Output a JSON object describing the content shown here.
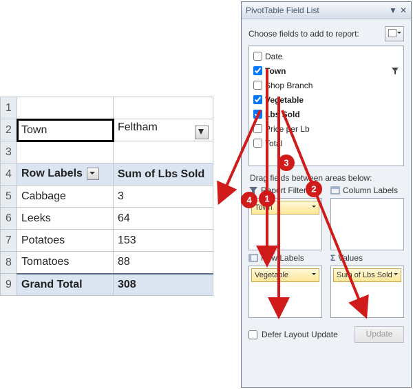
{
  "sheet": {
    "rows": [
      "1",
      "2",
      "3",
      "4",
      "5",
      "6",
      "7",
      "8",
      "9"
    ],
    "filter_label": "Town",
    "filter_value": "Feltham",
    "header_a": "Row Labels",
    "header_b": "Sum of Lbs Sold",
    "data": [
      {
        "label": "Cabbage",
        "value": "3"
      },
      {
        "label": "Leeks",
        "value": "64"
      },
      {
        "label": "Potatoes",
        "value": "153"
      },
      {
        "label": "Tomatoes",
        "value": "88"
      }
    ],
    "grand_label": "Grand Total",
    "grand_value": "308"
  },
  "panel": {
    "title": "PivotTable Field List",
    "choose": "Choose fields to add to report:",
    "fields": [
      {
        "label": "Date",
        "checked": false,
        "bold": false,
        "filtered": false
      },
      {
        "label": "Town",
        "checked": true,
        "bold": true,
        "filtered": true
      },
      {
        "label": "Shop Branch",
        "checked": false,
        "bold": false,
        "filtered": false
      },
      {
        "label": "Vegetable",
        "checked": true,
        "bold": true,
        "filtered": false
      },
      {
        "label": "Lbs Sold",
        "checked": true,
        "bold": true,
        "filtered": false
      },
      {
        "label": "Price per Lb",
        "checked": false,
        "bold": false,
        "filtered": false
      },
      {
        "label": "Total",
        "checked": false,
        "bold": false,
        "filtered": false
      }
    ],
    "drag": "Drag fields between areas below:",
    "area_filter": "Report Filter",
    "area_columns": "Column Labels",
    "area_rows": "Row Labels",
    "area_values": "Values",
    "chip_filter": "Town",
    "chip_rows": "Vegetable",
    "chip_values": "Sum of Lbs Sold",
    "defer": "Defer Layout Update",
    "update": "Update"
  },
  "badges": [
    "1",
    "2",
    "3",
    "4"
  ]
}
